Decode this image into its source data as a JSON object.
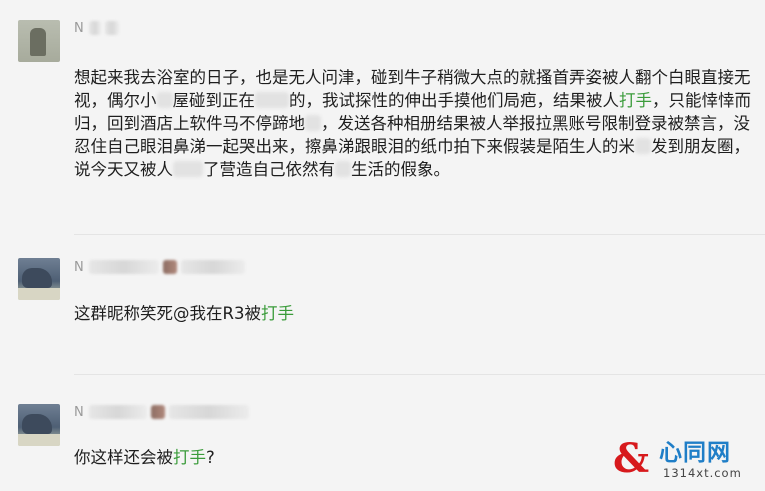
{
  "comments": [
    {
      "username": "N",
      "text_before": "想起来我去浴室的日子，也是无人问津，碰到牛子稍微大点的就搔首弄姿被人翻个白眼直接无视，偶尔小",
      "text_mid1": "屋碰到正在",
      "text_mid2": "的，我试探性的伸出手摸他们局疤，结果被人",
      "highlight": "打手",
      "text_mid3": "，只能悻悻而归，回到酒店上软件马不停蹄地",
      "text_mid4": "，发送各种相册结果被人举报拉黑账号限制登录被禁言，没忍住自己眼泪鼻涕一起哭出来，擦鼻涕跟眼泪的纸巾拍下来假装是陌生人的米",
      "text_mid5": "发到朋友圈，说今天又被人",
      "text_mid6": "了营造自己依然有",
      "text_end": "生活的假象。"
    },
    {
      "username": "N",
      "text_before": "这群昵称笑死@我在R3被",
      "highlight": "打手",
      "text_end": ""
    },
    {
      "username": "N",
      "text_before": "你这样还会被",
      "highlight": "打手",
      "text_end": "?"
    }
  ],
  "watermark": {
    "mark": "&",
    "title": "心同网",
    "url": "1314xt.com"
  },
  "colors": {
    "highlight": "#3a9b3a",
    "background": "#f4f4f4",
    "watermark_red": "#d7191c",
    "watermark_blue": "#1f7ec7"
  }
}
